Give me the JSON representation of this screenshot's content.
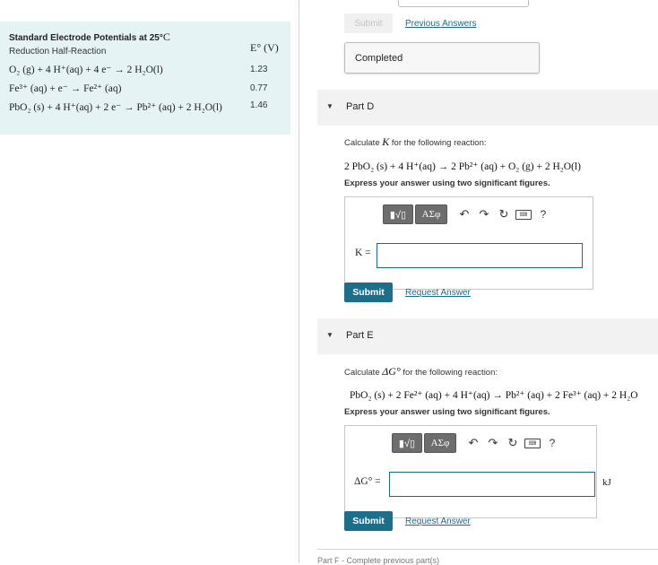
{
  "reference_table": {
    "title": "Standard Electrode Potentials at 25°",
    "title_unit": "C",
    "col_reaction": "Reduction Half-Reaction",
    "col_potential": "E° (V)",
    "rows": [
      {
        "reaction": "O₂ (g) + 4 H⁺(aq) + 4 e⁻ → 2 H₂O(l)",
        "potential": "1.23"
      },
      {
        "reaction": "Fe³⁺ (aq) + e⁻ → Fe²⁺ (aq)",
        "potential": "0.77"
      },
      {
        "reaction": "PbO₂ (s) + 4 H⁺(aq) + 2 e⁻ → Pb²⁺ (aq) + 2 H₂O(l)",
        "potential": "1.46"
      }
    ]
  },
  "previous_part": {
    "submit_label": "Submit",
    "previous_answers_link": "Previous Answers",
    "status": "Completed"
  },
  "part_d": {
    "title": "Part D",
    "prompt_before": "Calculate ",
    "prompt_symbol": "K",
    "prompt_after": " for the following reaction:",
    "equation": "2 PbO₂ (s) + 4 H⁺(aq) → 2 Pb²⁺ (aq) + O₂ (g) + 2 H₂O(l)",
    "instruction": "Express your answer using two significant figures.",
    "answer_label": "K =",
    "answer_value": "",
    "submit_label": "Submit",
    "request_answer_link": "Request Answer"
  },
  "part_e": {
    "title": "Part E",
    "prompt_before": "Calculate ",
    "prompt_symbol": "ΔG°",
    "prompt_after": " for the following reaction:",
    "equation": "PbO₂ (s) + 2 Fe²⁺ (aq) + 4 H⁺(aq) → Pb²⁺ (aq) + 2 Fe³⁺ (aq) + 2 H₂O",
    "instruction": "Express your answer using two significant figures.",
    "answer_label": "ΔG° =",
    "answer_value": "",
    "unit": "kJ",
    "submit_label": "Submit",
    "request_answer_link": "Request Answer"
  },
  "toolbar": {
    "template_label": "▮√▯",
    "greek_label": "ΑΣφ",
    "help_label": "?",
    "keyboard_label": "⌨"
  },
  "part_f_partial": "Part F - Complete previous part(s)",
  "colors": {
    "accent": "#1d6e8a",
    "panel_bg": "#e6f3f4",
    "header_bg": "#f2f2f2"
  }
}
